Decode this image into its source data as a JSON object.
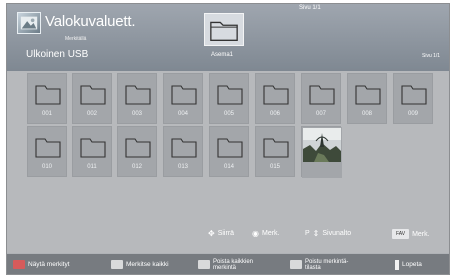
{
  "header": {
    "title": "Valokuvaluett.",
    "subtitle": "Merkitällä",
    "page_indicator_top": "Sivu 1/1",
    "device_label": "Asema1",
    "source_label": "Ulkoinen USB",
    "page_indicator_right": "Sivu 1/1"
  },
  "grid": {
    "folders": [
      "001",
      "002",
      "003",
      "004",
      "005",
      "006",
      "007",
      "008",
      "009",
      "010",
      "011",
      "012",
      "013",
      "014",
      "015"
    ]
  },
  "nav": {
    "move_label": "Siirrä",
    "mark_label": "Merk.",
    "page_prefix": "P",
    "page_label": "Sivunalto",
    "fav_badge": "FAV",
    "fav_label": "Merk."
  },
  "footer": {
    "show_marked": "Näytä merkityt",
    "mark_all": "Merkitse kaikki",
    "unmark_all_line1": "Poista kaikkien",
    "unmark_all_line2": "merkintä",
    "remove_marked_line1": "Poistu merkintä-",
    "remove_marked_line2": "tilasta",
    "exit": "Lopeta"
  },
  "colors": {
    "background": "#b7b9bc",
    "header": "#8d949c",
    "tile": "#a3a6aa",
    "footer": "#777b80"
  }
}
